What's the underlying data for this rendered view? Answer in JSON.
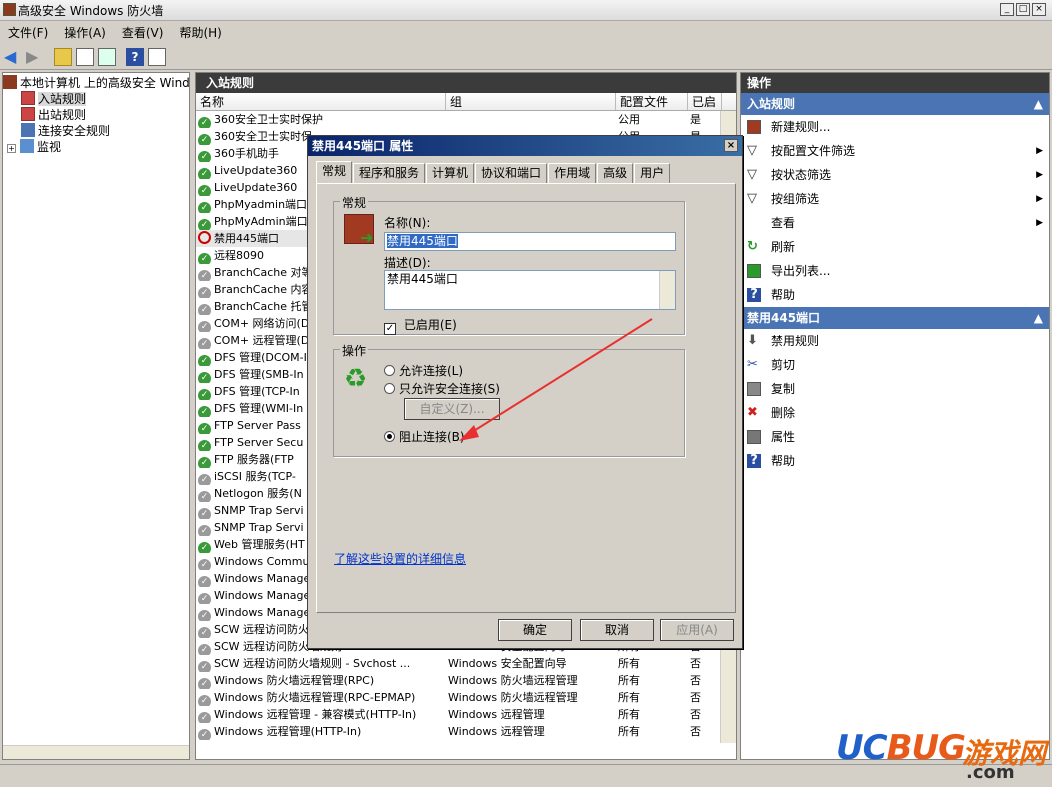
{
  "window": {
    "title": "高级安全 Windows 防火墙"
  },
  "menu": [
    "文件(F)",
    "操作(A)",
    "查看(V)",
    "帮助(H)"
  ],
  "tree": {
    "root": "本地计算机 上的高级安全 Windows",
    "items": [
      "入站规则",
      "出站规则",
      "连接安全规则",
      "监视"
    ]
  },
  "center": {
    "header": "入站规则",
    "columns": [
      "名称",
      "组",
      "配置文件",
      "已启"
    ],
    "rows": [
      {
        "name": "360安全卫士实时保护",
        "group": "",
        "profile": "公用",
        "enabled": "是",
        "state": "on"
      },
      {
        "name": "360安全卫士实时保",
        "group": "",
        "profile": "公用",
        "enabled": "是",
        "state": "on"
      },
      {
        "name": "360手机助手",
        "group": "",
        "profile": "",
        "enabled": "",
        "state": "on"
      },
      {
        "name": "LiveUpdate360",
        "group": "",
        "profile": "",
        "enabled": "",
        "state": "on"
      },
      {
        "name": "LiveUpdate360",
        "group": "",
        "profile": "",
        "enabled": "",
        "state": "on"
      },
      {
        "name": "PhpMyadmin端口",
        "group": "",
        "profile": "",
        "enabled": "",
        "state": "on"
      },
      {
        "name": "PhpMyAdmin端口",
        "group": "",
        "profile": "",
        "enabled": "",
        "state": "on"
      },
      {
        "name": "禁用445端口",
        "group": "",
        "profile": "",
        "enabled": "",
        "state": "block"
      },
      {
        "name": "远程8090",
        "group": "",
        "profile": "",
        "enabled": "",
        "state": "on"
      },
      {
        "name": "BranchCache 对等",
        "group": "",
        "profile": "",
        "enabled": "",
        "state": "off"
      },
      {
        "name": "BranchCache 内容",
        "group": "",
        "profile": "",
        "enabled": "",
        "state": "off"
      },
      {
        "name": "BranchCache 托管",
        "group": "",
        "profile": "",
        "enabled": "",
        "state": "off"
      },
      {
        "name": "COM+ 网络访问(D",
        "group": "",
        "profile": "",
        "enabled": "",
        "state": "off"
      },
      {
        "name": "COM+ 远程管理(D",
        "group": "",
        "profile": "",
        "enabled": "",
        "state": "off"
      },
      {
        "name": "DFS 管理(DCOM-I",
        "group": "",
        "profile": "",
        "enabled": "",
        "state": "on"
      },
      {
        "name": "DFS 管理(SMB-In",
        "group": "",
        "profile": "",
        "enabled": "",
        "state": "on"
      },
      {
        "name": "DFS 管理(TCP-In",
        "group": "",
        "profile": "",
        "enabled": "",
        "state": "on"
      },
      {
        "name": "DFS 管理(WMI-In",
        "group": "",
        "profile": "",
        "enabled": "",
        "state": "on"
      },
      {
        "name": "FTP Server Pass",
        "group": "",
        "profile": "",
        "enabled": "",
        "state": "on"
      },
      {
        "name": "FTP Server Secu",
        "group": "",
        "profile": "",
        "enabled": "",
        "state": "on"
      },
      {
        "name": "FTP 服务器(FTP",
        "group": "",
        "profile": "",
        "enabled": "",
        "state": "on"
      },
      {
        "name": "iSCSI 服务(TCP-",
        "group": "",
        "profile": "",
        "enabled": "",
        "state": "off"
      },
      {
        "name": "Netlogon 服务(N",
        "group": "",
        "profile": "",
        "enabled": "",
        "state": "off"
      },
      {
        "name": "SNMP Trap Servi",
        "group": "",
        "profile": "",
        "enabled": "",
        "state": "off"
      },
      {
        "name": "SNMP Trap Servi",
        "group": "",
        "profile": "",
        "enabled": "",
        "state": "off"
      },
      {
        "name": "Web 管理服务(HT",
        "group": "",
        "profile": "",
        "enabled": "",
        "state": "on"
      },
      {
        "name": "Windows Communi",
        "group": "",
        "profile": "",
        "enabled": "",
        "state": "off"
      },
      {
        "name": "Windows Managem",
        "group": "",
        "profile": "",
        "enabled": "",
        "state": "off"
      },
      {
        "name": "Windows Managem",
        "group": "",
        "profile": "",
        "enabled": "",
        "state": "off"
      },
      {
        "name": "Windows Managem",
        "group": "",
        "profile": "",
        "enabled": "",
        "state": "off"
      },
      {
        "name": "SCW 远程访问防火",
        "group": "",
        "profile": "",
        "enabled": "",
        "state": "off"
      },
      {
        "name": "SCW 远程访问防火墙规则 - Svchost ...",
        "group": "Windows 安全配置向导",
        "profile": "所有",
        "enabled": "否",
        "state": "off"
      },
      {
        "name": "SCW 远程访问防火墙规则 - Svchost ...",
        "group": "Windows 安全配置向导",
        "profile": "所有",
        "enabled": "否",
        "state": "off"
      },
      {
        "name": "Windows 防火墙远程管理(RPC)",
        "group": "Windows 防火墙远程管理",
        "profile": "所有",
        "enabled": "否",
        "state": "off"
      },
      {
        "name": "Windows 防火墙远程管理(RPC-EPMAP)",
        "group": "Windows 防火墙远程管理",
        "profile": "所有",
        "enabled": "否",
        "state": "off"
      },
      {
        "name": "Windows 远程管理 - 兼容模式(HTTP-In)",
        "group": "Windows 远程管理",
        "profile": "所有",
        "enabled": "否",
        "state": "off"
      },
      {
        "name": "Windows 远程管理(HTTP-In)",
        "group": "Windows 远程管理",
        "profile": "所有",
        "enabled": "否",
        "state": "off"
      }
    ]
  },
  "actions": {
    "header": "操作",
    "section1": "入站规则",
    "items1": [
      {
        "label": "新建规则...",
        "icon": "new-rule-icon",
        "sub": false
      },
      {
        "label": "按配置文件筛选",
        "icon": "filter-icon",
        "sub": true
      },
      {
        "label": "按状态筛选",
        "icon": "filter-icon",
        "sub": true
      },
      {
        "label": "按组筛选",
        "icon": "filter-icon",
        "sub": true
      },
      {
        "label": "查看",
        "icon": "",
        "sub": true
      },
      {
        "label": "刷新",
        "icon": "refresh-icon",
        "sub": false
      },
      {
        "label": "导出列表...",
        "icon": "export-icon",
        "sub": false
      },
      {
        "label": "帮助",
        "icon": "help-icon",
        "sub": false
      }
    ],
    "section2": "禁用445端口",
    "items2": [
      {
        "label": "禁用规则",
        "icon": "disable-icon"
      },
      {
        "label": "剪切",
        "icon": "cut-icon"
      },
      {
        "label": "复制",
        "icon": "copy-icon"
      },
      {
        "label": "删除",
        "icon": "delete-icon"
      },
      {
        "label": "属性",
        "icon": "properties-icon"
      },
      {
        "label": "帮助",
        "icon": "help-icon"
      }
    ]
  },
  "dialog": {
    "title": "禁用445端口 属性",
    "tabs": [
      "常规",
      "程序和服务",
      "计算机",
      "协议和端口",
      "作用域",
      "高级",
      "用户"
    ],
    "general_group": "常规",
    "name_label": "名称(N):",
    "name_value": "禁用445端口",
    "desc_label": "描述(D):",
    "desc_value": "禁用445端口",
    "enabled_label": "已启用(E)",
    "action_group": "操作",
    "radio_allow": "允许连接(L)",
    "radio_secure": "只允许安全连接(S)",
    "customize": "自定义(Z)...",
    "radio_block": "阻止连接(B)",
    "link": "了解这些设置的详细信息",
    "ok": "确定",
    "cancel": "取消",
    "apply": "应用(A)"
  },
  "watermark": {
    "brand": "UCBUG游戏网",
    "suffix": ".com"
  }
}
